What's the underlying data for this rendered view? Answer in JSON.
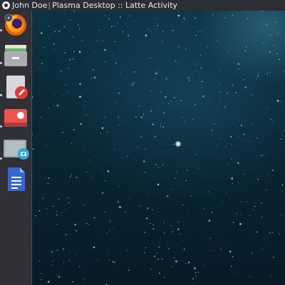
{
  "topbar": {
    "user": "John Doe",
    "separator": "|",
    "activity": "Plasma Desktop :: Latte Activity"
  },
  "dock": {
    "items": [
      {
        "name": "firefox",
        "icon": "firefox-icon",
        "running": true
      },
      {
        "name": "file-manager",
        "icon": "file-cabinet-icon",
        "running": true
      },
      {
        "name": "text-editor",
        "icon": "document-edit-icon",
        "running": true
      },
      {
        "name": "image-viewer",
        "icon": "photo-viewer-icon",
        "running": true
      },
      {
        "name": "screenshot-tool",
        "icon": "camera-icon",
        "running": true
      },
      {
        "name": "documents",
        "icon": "document-icon",
        "running": false
      }
    ]
  },
  "colors": {
    "topbar": "#2b2e33",
    "dock": "#2f3136",
    "desktop": "#0a2634"
  }
}
